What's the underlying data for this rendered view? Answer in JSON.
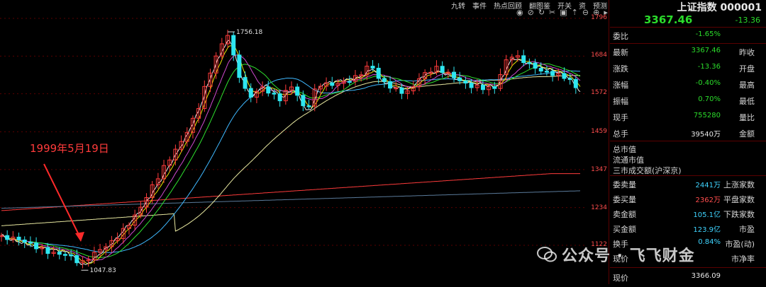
{
  "toolbar": {
    "items": [
      "九转",
      "事件",
      "热点回顾",
      "翻图鉴",
      "开关",
      "资",
      "预测"
    ]
  },
  "toolicons": [
    "eye-icon",
    "eye-off-icon",
    "refresh-icon",
    "scissors-icon",
    "lock-icon",
    "up-icon",
    "minus-icon",
    "plus-icon",
    "play-icon"
  ],
  "price_axis": {
    "ticks": [
      "1796",
      "1684",
      "1572",
      "1459",
      "1347",
      "1234",
      "1122"
    ]
  },
  "chart": {
    "high_label": "1756.18",
    "low_label": "1047.83",
    "annotation": "1999年5月19日",
    "colors": {
      "up": "#ff3b3b",
      "down": "#2ee6f0",
      "ma5": "#e8e8e8",
      "ma10": "#e6e600",
      "ma20": "#d04ad0",
      "ma30": "#2ee02e",
      "ma60": "#3fb8ff",
      "ma120": "#e8e8a0",
      "ma250": "#ff3b3b"
    }
  },
  "panel": {
    "title": "上证指数 000001",
    "price": "3367.46",
    "change": "-13.36",
    "rows1": [
      {
        "label": "委比",
        "value": "-1.65%",
        "label2": "",
        "color": "green"
      }
    ],
    "rows2": [
      {
        "label": "最新",
        "value": "3367.46",
        "label2": "昨收",
        "color": "green"
      },
      {
        "label": "涨跌",
        "value": "-13.36",
        "label2": "开盘",
        "color": "green"
      },
      {
        "label": "涨幅",
        "value": "-0.40%",
        "label2": "最高",
        "color": "green"
      },
      {
        "label": "振幅",
        "value": "0.70%",
        "label2": "最低",
        "color": "green"
      },
      {
        "label": "现手",
        "value": "755280",
        "label2": "量比",
        "color": "green"
      },
      {
        "label": "总手",
        "value": "39540万",
        "label2": "金额",
        "color": "white"
      }
    ],
    "rows3": [
      "总市值",
      "流通市值",
      "三市成交额(沪深京)"
    ],
    "rows4": [
      {
        "label": "委卖量",
        "value": "2441万",
        "label2": "上涨家数",
        "color": "cyan"
      },
      {
        "label": "委买量",
        "value": "2362万",
        "label2": "平盘家数",
        "color": "red"
      },
      {
        "label": "卖金额",
        "value": "105.1亿",
        "label2": "下跌家数",
        "color": "cyan"
      },
      {
        "label": "买金额",
        "value": "123.9亿",
        "label2": "市盈",
        "color": "cyan"
      },
      {
        "label": "换手",
        "value": "0.84%",
        "label2": "市盈(动)",
        "color": "cyan"
      },
      {
        "label": "现价",
        "value": "",
        "label2": "市净率",
        "color": "white"
      }
    ],
    "last": {
      "label": "现价",
      "value": "3366.09"
    }
  },
  "watermark": "公众号 · 飞飞财金"
}
